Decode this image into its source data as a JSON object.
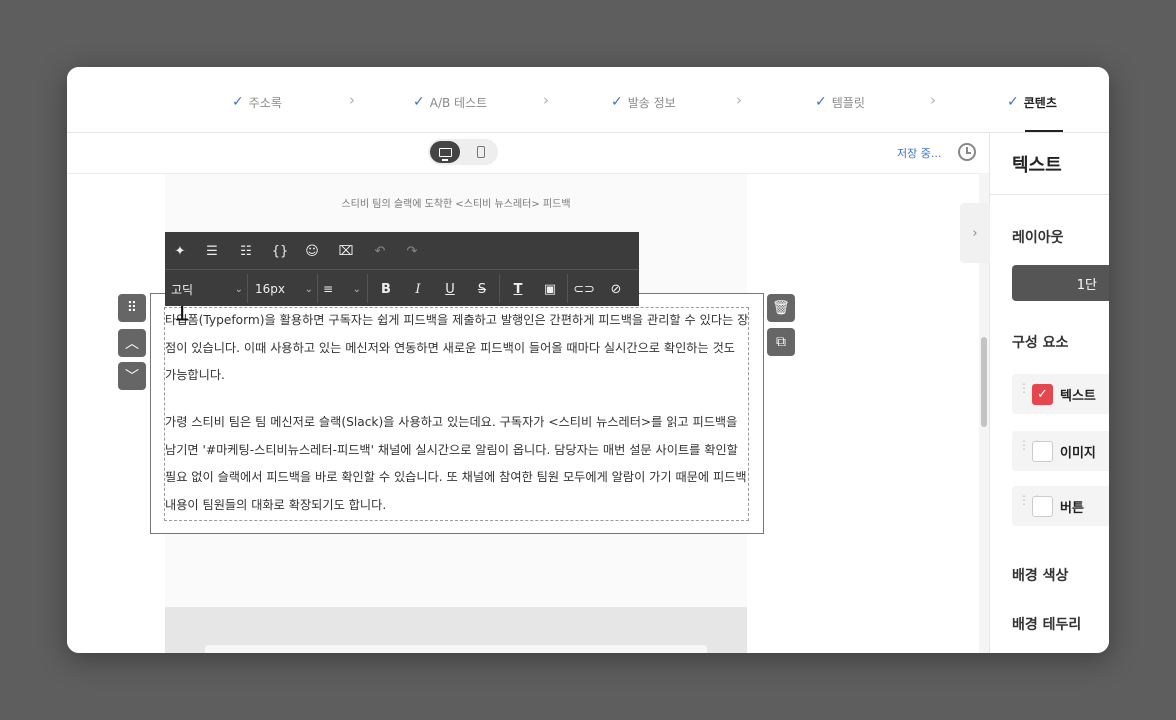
{
  "steps": [
    {
      "label": "주소록",
      "state": "done"
    },
    {
      "label": "A/B 테스트",
      "state": "done"
    },
    {
      "label": "발송 정보",
      "state": "done"
    },
    {
      "label": "템플릿",
      "state": "done"
    },
    {
      "label": "콘텐츠",
      "state": "active"
    }
  ],
  "step_separator": "›",
  "check_glyph": "✓",
  "device_toggle": {
    "selected": "desktop",
    "options": [
      "desktop",
      "mobile"
    ]
  },
  "save_status": "저장 중...",
  "email": {
    "header_text": "스티비 팀의 슬랙에 도착한 <스티비 뉴스레터> 피드백",
    "paragraph_1": "타입폼(Typeform)을 활용하면 구독자는 쉽게 피드백을 제출하고 발행인은 간편하게 피드백을 관리할 수 있다는 장점이 있습니다. 이때 사용하고 있는 메신저와 연동하면 새로운 피드백이 들어올 때마다 실시간으로 확인하는 것도 가능합니다.",
    "paragraph_2": "가령 스티비 팀은 팀 메신저로 슬랙(Slack)을 사용하고 있는데요. 구독자가 <스티비 뉴스레터>를 읽고 피드백을 남기면 '#마케팅-스티비뉴스레터-피드백' 채널에 실시간으로 알림이 옵니다. 담당자는 매번 설문 사이트를 확인할 필요 없이 슬랙에서 피드백을 바로 확인할 수 있습니다. 또 채널에 참여한 팀원 모두에게 알람이 가기 때문에 피드백 내용이 팀원들의 대화로 확장되기도 합니다."
  },
  "toolbar": {
    "row1": [
      "sparkle-icon",
      "ordered-list-icon",
      "bullet-list-icon",
      "code-icon",
      "emoji-icon",
      "clear-format-icon",
      "undo-icon",
      "redo-icon"
    ],
    "font_family": "고딕",
    "font_size": "16px",
    "align": "left",
    "bold": "B",
    "italic": "I",
    "underline": "U",
    "strike": "S",
    "text_color": "T"
  },
  "right_panel": {
    "title": "텍스트",
    "layout_label": "레이아웃",
    "layout_value": "1단",
    "components_label": "구성 요소",
    "components": [
      {
        "label": "텍스트",
        "checked": true
      },
      {
        "label": "이미지",
        "checked": false
      },
      {
        "label": "버튼",
        "checked": false
      }
    ],
    "background_color_label": "배경 색상",
    "background_border_label": "배경 테두리"
  },
  "colors": {
    "accent": "#3c74c9",
    "check_red": "#e5474e",
    "toolbar_bg": "#3c3c3c",
    "backdrop": "#5e5e5e"
  }
}
